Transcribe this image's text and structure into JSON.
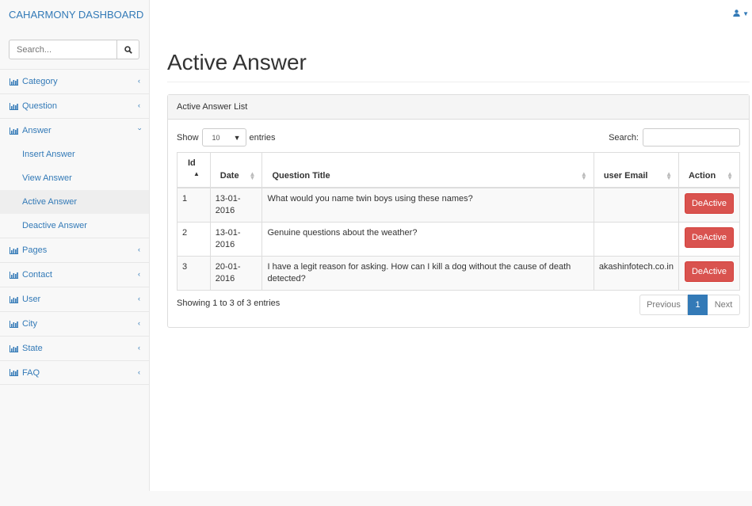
{
  "brand": "CAHARMONY DASHBOARD",
  "sidebar": {
    "search_placeholder": "Search...",
    "items": [
      {
        "label": "Category"
      },
      {
        "label": "Question"
      },
      {
        "label": "Answer"
      },
      {
        "label": "Pages"
      },
      {
        "label": "Contact"
      },
      {
        "label": "User"
      },
      {
        "label": "City"
      },
      {
        "label": "State"
      },
      {
        "label": "FAQ"
      }
    ],
    "answer_sub": [
      {
        "label": "Insert Answer"
      },
      {
        "label": "View Answer"
      },
      {
        "label": "Active Answer"
      },
      {
        "label": "Deactive Answer"
      }
    ]
  },
  "page": {
    "title": "Active Answer",
    "panel_heading": "Active Answer List",
    "show_label": "Show",
    "entries_label": "entries",
    "page_length": "10",
    "search_label": "Search:",
    "info": "Showing 1 to 3 of 3 entries",
    "pager": {
      "prev": "Previous",
      "current": "1",
      "next": "Next"
    }
  },
  "table": {
    "headers": {
      "id": "Id",
      "date": "Date",
      "question": "Question Title",
      "email": "user Email",
      "action": "Action"
    },
    "rows": [
      {
        "id": "1",
        "date": "13-01-2016",
        "question": "What would you name twin boys using these names?",
        "email": "",
        "action": "DeActive"
      },
      {
        "id": "2",
        "date": "13-01-2016",
        "question": "Genuine questions about the weather?",
        "email": "",
        "action": "DeActive"
      },
      {
        "id": "3",
        "date": "20-01-2016",
        "question": "I have a legit reason for asking. How can I kill a dog without the cause of death detected?",
        "email": "akashinfotech.co.in",
        "action": "DeActive"
      }
    ]
  },
  "colors": {
    "link": "#337ab7",
    "danger": "#d9534f",
    "active_page": "#337ab7"
  },
  "icons": {
    "nav": "bar-chart-icon",
    "user": "user-icon",
    "search": "search-icon"
  }
}
